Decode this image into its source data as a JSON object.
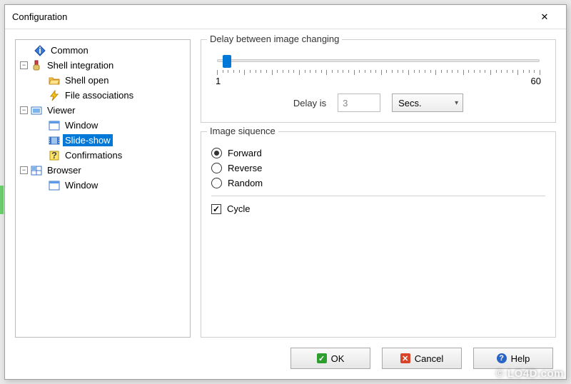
{
  "window": {
    "title": "Configuration"
  },
  "tree": {
    "items": [
      {
        "label": "Common",
        "icon": "diamond"
      },
      {
        "label": "Shell integration",
        "icon": "shell"
      },
      {
        "label": "Shell open",
        "icon": "folder-open"
      },
      {
        "label": "File associations",
        "icon": "lightning"
      },
      {
        "label": "Viewer",
        "icon": "viewer"
      },
      {
        "label": "Window",
        "icon": "window"
      },
      {
        "label": "Slide-show",
        "icon": "film"
      },
      {
        "label": "Confirmations",
        "icon": "question"
      },
      {
        "label": "Browser",
        "icon": "browser"
      },
      {
        "label": "Window",
        "icon": "window"
      }
    ]
  },
  "delay": {
    "group_title": "Delay between image changing",
    "min": "1",
    "max": "60",
    "label": "Delay is",
    "value": "3",
    "unit": "Secs."
  },
  "sequence": {
    "group_title": "Image siquence",
    "options": {
      "forward": "Forward",
      "reverse": "Reverse",
      "random": "Random"
    },
    "selected": "forward",
    "cycle_label": "Cycle",
    "cycle_checked": true
  },
  "buttons": {
    "ok": "OK",
    "cancel": "Cancel",
    "help": "Help"
  },
  "watermark": "© LO4D.com"
}
